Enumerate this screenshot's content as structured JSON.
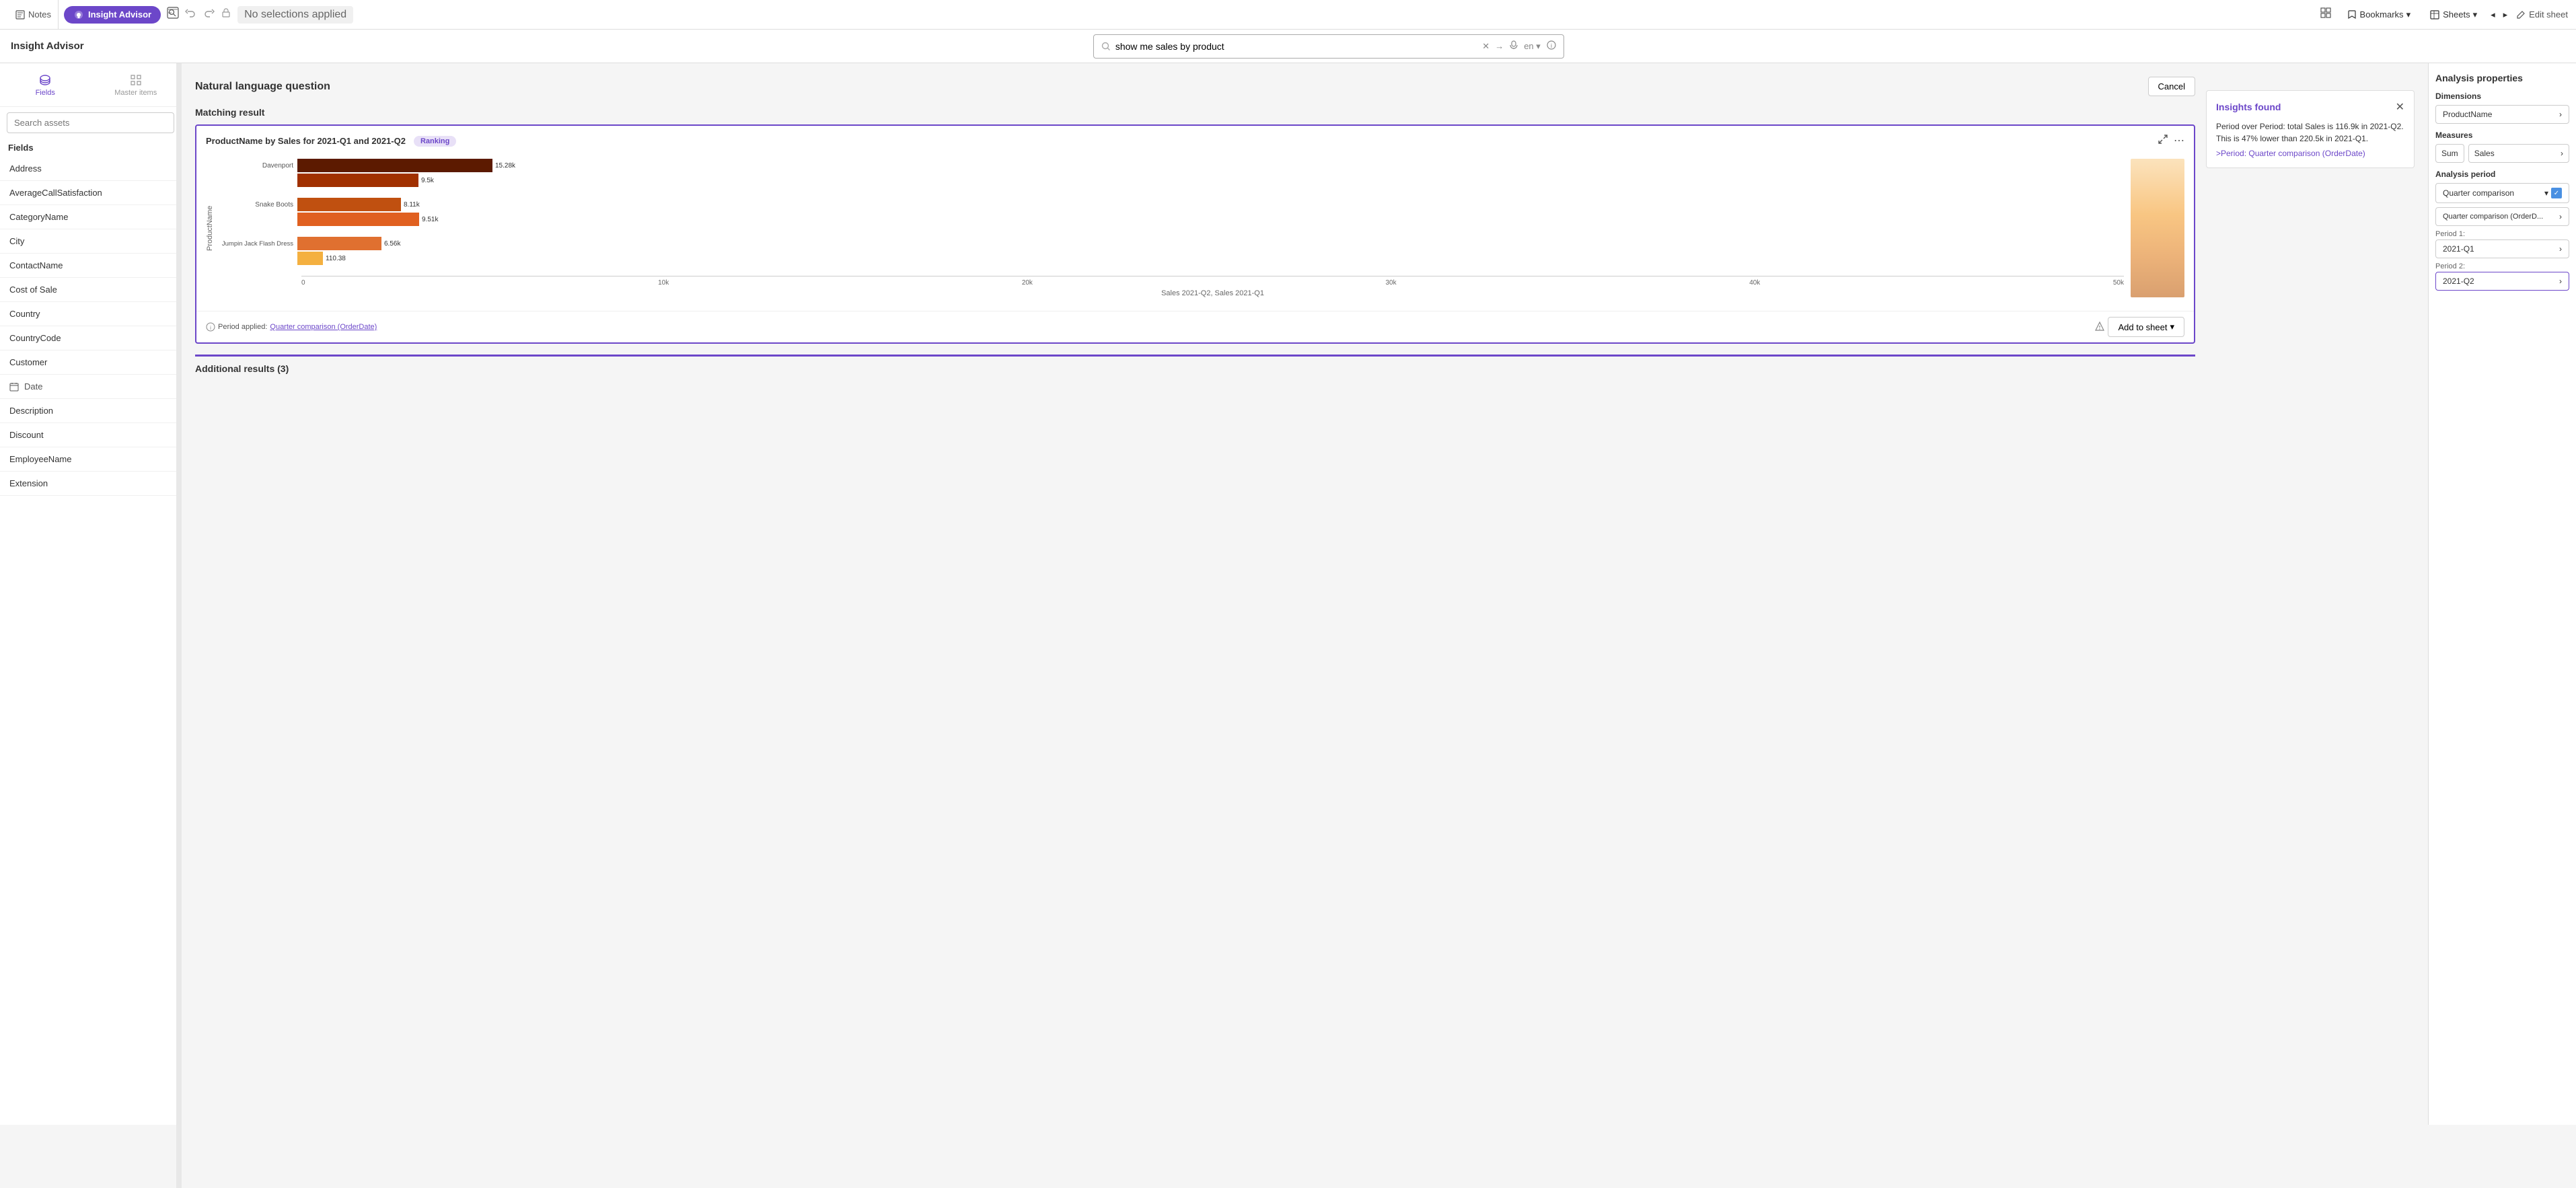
{
  "topbar": {
    "notes_label": "Notes",
    "insight_advisor_label": "Insight Advisor",
    "no_selections_label": "No selections applied",
    "bookmarks_label": "Bookmarks",
    "sheets_label": "Sheets",
    "edit_sheet_label": "Edit sheet"
  },
  "secondbar": {
    "insight_advisor_title": "Insight Advisor",
    "search_value": "show me sales by product",
    "search_placeholder": "show me sales by product",
    "lang": "en"
  },
  "sidebar": {
    "search_placeholder": "Search assets",
    "fields_header": "Fields",
    "items": [
      {
        "label": "Address",
        "icon": false
      },
      {
        "label": "AverageCallSatisfaction",
        "icon": false
      },
      {
        "label": "CategoryName",
        "icon": false
      },
      {
        "label": "City",
        "icon": false
      },
      {
        "label": "ContactName",
        "icon": false
      },
      {
        "label": "Cost of Sale",
        "icon": false
      },
      {
        "label": "Country",
        "icon": false
      },
      {
        "label": "CountryCode",
        "icon": false
      },
      {
        "label": "Customer",
        "icon": false
      },
      {
        "label": "Date",
        "icon": true
      },
      {
        "label": "Description",
        "icon": false
      },
      {
        "label": "Discount",
        "icon": false
      },
      {
        "label": "EmployeeName",
        "icon": false
      },
      {
        "label": "Extension",
        "icon": false
      }
    ],
    "nav_items": [
      {
        "label": "Fields",
        "active": true
      },
      {
        "label": "Master items",
        "active": false
      }
    ]
  },
  "main": {
    "nlq_header": "Natural language question",
    "cancel_btn": "Cancel",
    "matching_result_label": "Matching result",
    "chart": {
      "title": "ProductName by Sales for 2021-Q1 and 2021-Q2",
      "badge": "Ranking",
      "products": [
        {
          "label": "Davenport",
          "bars": [
            {
              "value": "15.28k",
              "width_pct": 29,
              "color": "dark-red"
            },
            {
              "value": "9.5k",
              "width_pct": 18,
              "color": "medium-red"
            }
          ]
        },
        {
          "label": "Snake Boots",
          "bars": [
            {
              "value": "8.11k",
              "width_pct": 15,
              "color": "orange"
            },
            {
              "value": "9.51k",
              "width_pct": 18,
              "color": "orange"
            }
          ]
        },
        {
          "label": "Jumpin Jack Flash Dress",
          "bars": [
            {
              "value": "6.56k",
              "width_pct": 12,
              "color": "light-orange"
            },
            {
              "value": "110.38",
              "width_pct": 2,
              "color": "yellow-orange"
            }
          ]
        }
      ],
      "x_axis_labels": [
        "0",
        "10k",
        "20k",
        "30k",
        "40k",
        "50k"
      ],
      "x_axis_title": "Sales 2021-Q2, Sales 2021-Q1",
      "y_axis_title": "ProductName",
      "period_applied": "Period applied:",
      "period_value": "Quarter comparison (OrderDate)",
      "add_to_sheet": "Add to sheet"
    },
    "additional_results": "Additional results (3)"
  },
  "insights": {
    "title": "Insights found",
    "text": "Period over Period: total Sales is 116.9k in 2021-Q2. This is 47% lower than 220.5k in 2021-Q1.",
    "link": ">Period: Quarter comparison (OrderDate)"
  },
  "analysis_properties": {
    "title": "Analysis properties",
    "dimensions_label": "Dimensions",
    "product_name_chip": "ProductName",
    "measures_label": "Measures",
    "sum_chip": "Sum",
    "sales_chip": "Sales",
    "analysis_period_label": "Analysis period",
    "period_select_value": "Quarter comparison",
    "period_select_option": "Quarter comparison (OrderD...",
    "period1_label": "Period 1:",
    "period1_value": "2021-Q1",
    "period2_label": "Period 2:",
    "period2_value": "2021-Q2"
  }
}
